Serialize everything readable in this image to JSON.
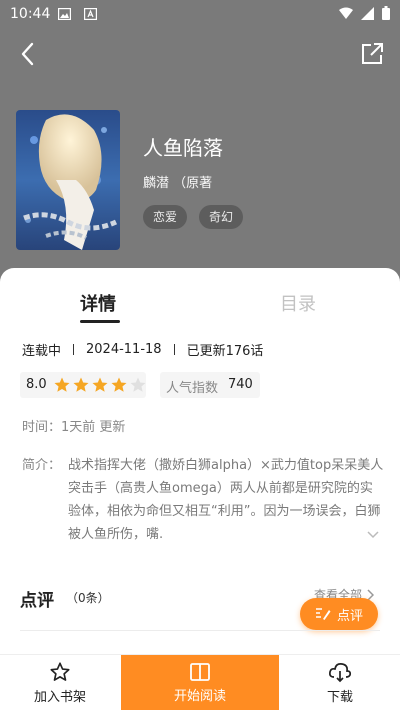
{
  "status_bar": {
    "time": "10:44"
  },
  "book": {
    "title": "人鱼陷落",
    "author": "麟潜 （原著",
    "tags": [
      "恋爱",
      "奇幻"
    ]
  },
  "tabs": {
    "details": "详情",
    "catalog": "目录"
  },
  "meta": {
    "status": "连载中",
    "date": "2024-11-18",
    "updated": "已更新176话"
  },
  "rating": {
    "score": "8.0",
    "stars": 4,
    "max_stars": 5
  },
  "popularity": {
    "label": "人气指数",
    "value": "740"
  },
  "time_row": "时间：1天前 更新",
  "description": {
    "label": "简介：",
    "text": "战术指挥大佬（撒娇白狮alpha）×武力值top呆呆美人突击手（高贵人鱼omega）两人从前都是研究院的实验体，相依为命但又相互“利用”。因为一场误会，白狮被人鱼所伤，嘴."
  },
  "reviews": {
    "title": "点评",
    "count": "（0条）",
    "view_all": "查看全部",
    "review_button": "点评"
  },
  "bottom_bar": {
    "add_shelf": "加入书架",
    "start_read": "开始阅读",
    "download": "下载"
  },
  "colors": {
    "accent": "#ff8c22",
    "header_bg": "#7a7a7a"
  }
}
